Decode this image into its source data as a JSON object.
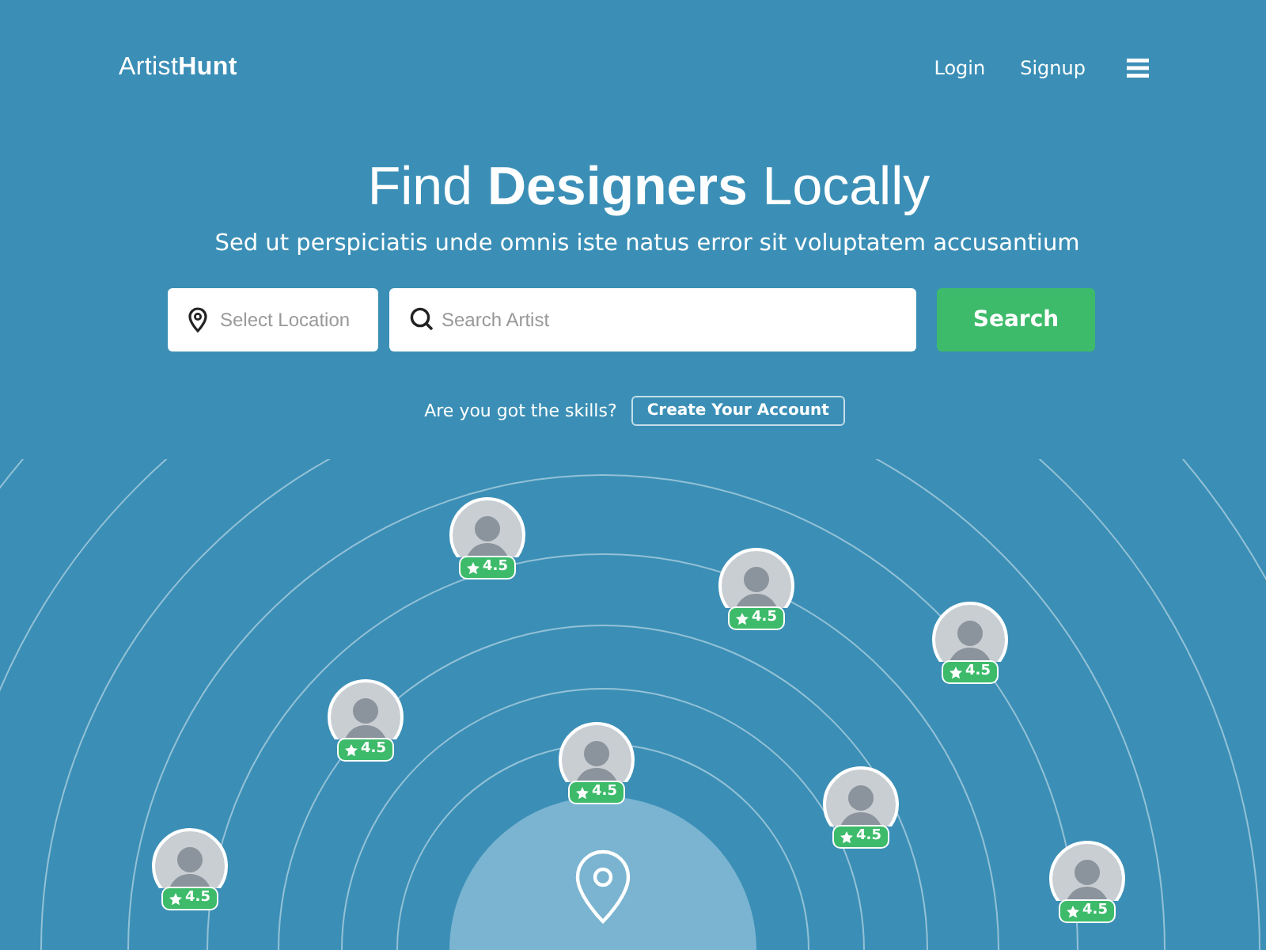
{
  "header": {
    "logo": "Artist**Hunt**",
    "nav": [
      "Login",
      "Signup"
    ]
  },
  "hero": {
    "title": "Find **Designers** Locally",
    "subtitle": "Sed ut perspiciatis unde omnis iste natus error sit voluptatem accusantium"
  },
  "search": {
    "location_placeholder": "Select Location",
    "artist_placeholder": "Search Artist",
    "button": "Search"
  },
  "signup": {
    "prompt": "Are you got the skills?",
    "button": "Create Your Account"
  },
  "artists": [
    {
      "rating": "4.5"
    },
    {
      "rating": "4.5"
    },
    {
      "rating": "4.5"
    },
    {
      "rating": "4.5"
    },
    {
      "rating": "4.5"
    },
    {
      "rating": "4.5"
    },
    {
      "rating": "4.5"
    },
    {
      "rating": "4.5"
    }
  ]
}
